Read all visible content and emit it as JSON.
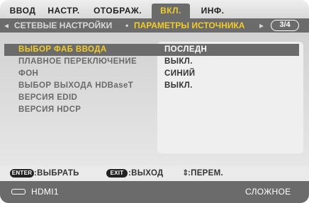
{
  "tabs": [
    {
      "label": "ВВОД",
      "active": false
    },
    {
      "label": "НАСТР.",
      "active": false
    },
    {
      "label": "ОТОБРАЖ.",
      "active": false
    },
    {
      "label": "ВКЛ.",
      "active": true
    },
    {
      "label": "ИНФ.",
      "active": false
    }
  ],
  "subtabs": {
    "left_arrow": "◂",
    "inactive": "СЕТЕВЫЕ НАСТРОЙКИ",
    "separator": "•",
    "active": "ПАРАМЕТРЫ ИСТОЧНИКА",
    "right_arrow": "▸",
    "page_indicator": "3/4"
  },
  "menu": [
    {
      "label": "ВЫБОР ФАБ ВВОДА",
      "value": "ПОСЛЕДН",
      "selected": true
    },
    {
      "label": "ПЛАВНОЕ ПЕРЕКЛЮЧЕНИЕ",
      "value": "ВЫКЛ.",
      "selected": false
    },
    {
      "label": "ФОН",
      "value": "СИНИЙ",
      "selected": false
    },
    {
      "label": "ВЫБОР ВЫХОДА HDBaseT",
      "value": "ВЫКЛ.",
      "selected": false
    },
    {
      "label": "ВЕРСИЯ EDID",
      "value": "",
      "selected": false
    },
    {
      "label": "ВЕРСИЯ HDCP",
      "value": "",
      "selected": false
    }
  ],
  "help": {
    "enter_key": "ENTER",
    "enter_text": ":ВЫБРАТЬ",
    "exit_key": "EXIT",
    "exit_text": ":ВЫХОД",
    "move_symbol": "⇕",
    "move_text": ":ПЕРЕМ."
  },
  "status": {
    "input_name": "HDMI1",
    "mode": "СЛОЖНОЕ"
  },
  "colors": {
    "highlight": "#f2cc29",
    "bar": "#6b6b6b"
  }
}
